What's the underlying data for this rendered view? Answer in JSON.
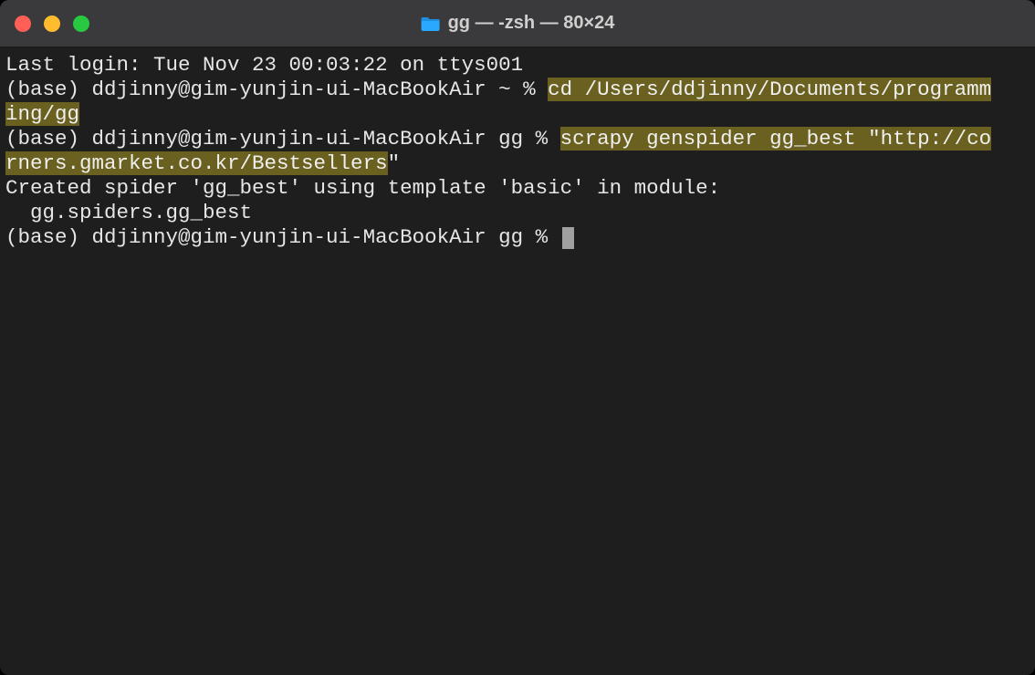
{
  "window": {
    "title": "gg — -zsh — 80×24"
  },
  "terminal": {
    "last_login": "Last login: Tue Nov 23 00:03:22 on ttys001",
    "prompt1_prefix": "(base) ddjinny@gim-yunjin-ui-MacBookAir ~ % ",
    "cmd1_a": "cd /Users/ddjinny/Documents/programm",
    "cmd1_b": "ing/gg",
    "prompt2_prefix": "(base) ddjinny@gim-yunjin-ui-MacBookAir gg % ",
    "cmd2_a": "scrapy genspider gg_best \"http://co",
    "cmd2_b": "rners.gmarket.co.kr/Bestsellers",
    "cmd2_tail": "\"",
    "out1": "Created spider 'gg_best' using template 'basic' in module:",
    "out2": "  gg.spiders.gg_best",
    "prompt3": "(base) ddjinny@gim-yunjin-ui-MacBookAir gg % "
  },
  "colors": {
    "highlight_bg": "#6a601f",
    "terminal_bg": "#1e1e1e",
    "titlebar_bg": "#3a3a3c"
  }
}
